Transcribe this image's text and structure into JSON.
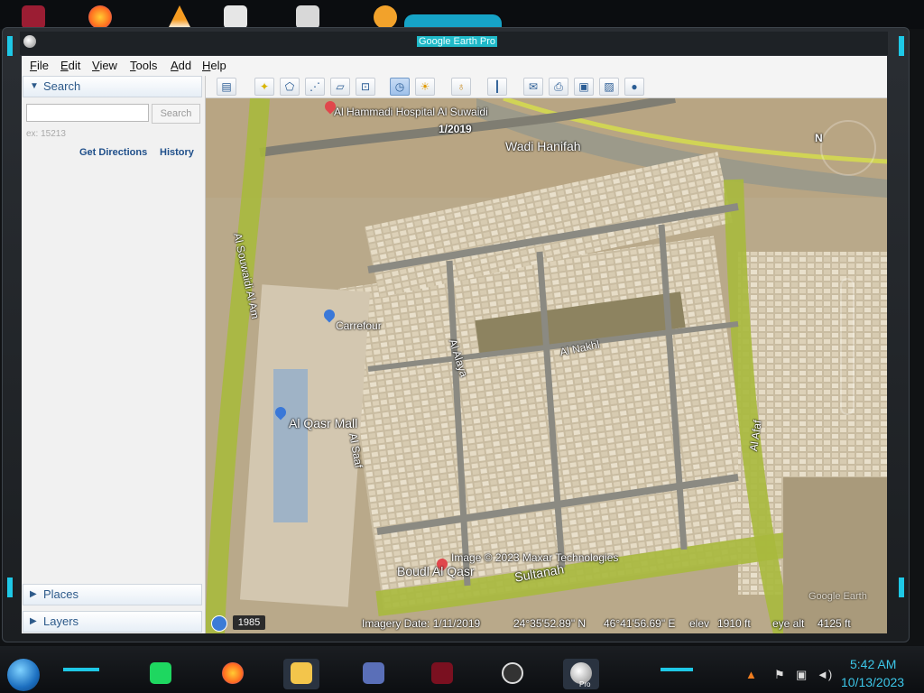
{
  "window": {
    "title": "Google Earth Pro"
  },
  "menu": [
    "File",
    "Edit",
    "View",
    "Tools",
    "Add",
    "Help"
  ],
  "search_panel": {
    "header": "Search",
    "input_value": "",
    "search_button": "Search",
    "hint": "ex: 15213",
    "get_directions": "Get Directions",
    "history": "History"
  },
  "places_panel": {
    "header": "Places"
  },
  "layers_panel": {
    "header": "Layers"
  },
  "map": {
    "labels": {
      "hospital": "Al Hammadi Hospital Al Suwaidi",
      "date_tag": "1/2019",
      "wadi": "Wadi Hanifah",
      "carrefour": "Carrefour",
      "mall": "Al Qasr Mall",
      "saaf": "Al Saaf",
      "alaya": "Al Alaya",
      "nakhl": "Al Nakhl",
      "afaf": "Al Afaf",
      "souwaidi": "Al Souwaidi Al Am",
      "sultanah": "Sultanah",
      "boudl": "Boudl Al Qasr",
      "credit": "Image © 2023 Maxar Technologies",
      "watermark": "Google Earth",
      "north": "N"
    },
    "status": {
      "year": "1985",
      "imagery_date": "Imagery Date: 1/11/2019",
      "lat": "24°35'52.89\" N",
      "lon": "46°41'56.69\" E",
      "elev_label": "elev",
      "elev": "1910 ft",
      "eye_label": "eye alt",
      "eye": "4125 ft"
    }
  },
  "taskbar": {
    "time": "5:42 AM",
    "date": "10/13/2023",
    "google_earth_tag": "Pro"
  },
  "colors": {
    "accent": "#1ec8e6",
    "link": "#1f4f8a",
    "clock": "#3cc6e8"
  }
}
